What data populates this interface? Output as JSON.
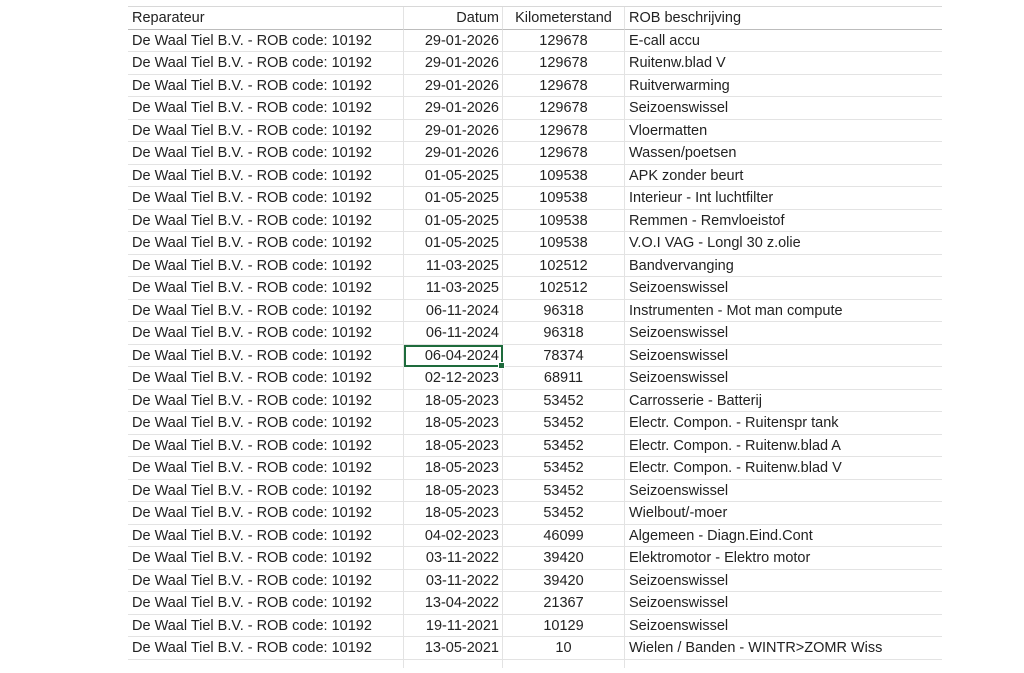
{
  "sheet": {
    "headers": {
      "reparateur": "Reparateur",
      "datum": "Datum",
      "kilometerstand": "Kilometerstand",
      "rob": "ROB beschrijving"
    },
    "selected_row_index": 14,
    "selection_color": "#1e6b3c",
    "rows": [
      {
        "reparateur": "De Waal Tiel B.V. - ROB code: 10192",
        "datum": "29-01-2026",
        "km": "129678",
        "rob": "E-call accu"
      },
      {
        "reparateur": "De Waal Tiel B.V. - ROB code: 10192",
        "datum": "29-01-2026",
        "km": "129678",
        "rob": "Ruitenw.blad V"
      },
      {
        "reparateur": "De Waal Tiel B.V. - ROB code: 10192",
        "datum": "29-01-2026",
        "km": "129678",
        "rob": "Ruitverwarming"
      },
      {
        "reparateur": "De Waal Tiel B.V. - ROB code: 10192",
        "datum": "29-01-2026",
        "km": "129678",
        "rob": "Seizoenswissel"
      },
      {
        "reparateur": "De Waal Tiel B.V. - ROB code: 10192",
        "datum": "29-01-2026",
        "km": "129678",
        "rob": "Vloermatten"
      },
      {
        "reparateur": "De Waal Tiel B.V. - ROB code: 10192",
        "datum": "29-01-2026",
        "km": "129678",
        "rob": "Wassen/poetsen"
      },
      {
        "reparateur": "De Waal Tiel B.V. - ROB code: 10192",
        "datum": "01-05-2025",
        "km": "109538",
        "rob": "APK zonder beurt"
      },
      {
        "reparateur": "De Waal Tiel B.V. - ROB code: 10192",
        "datum": "01-05-2025",
        "km": "109538",
        "rob": "Interieur - Int luchtfilter"
      },
      {
        "reparateur": "De Waal Tiel B.V. - ROB code: 10192",
        "datum": "01-05-2025",
        "km": "109538",
        "rob": "Remmen - Remvloeistof"
      },
      {
        "reparateur": "De Waal Tiel B.V. - ROB code: 10192",
        "datum": "01-05-2025",
        "km": "109538",
        "rob": "V.O.I VAG - Longl 30 z.olie"
      },
      {
        "reparateur": "De Waal Tiel B.V. - ROB code: 10192",
        "datum": "11-03-2025",
        "km": "102512",
        "rob": "Bandvervanging"
      },
      {
        "reparateur": "De Waal Tiel B.V. - ROB code: 10192",
        "datum": "11-03-2025",
        "km": "102512",
        "rob": "Seizoenswissel"
      },
      {
        "reparateur": "De Waal Tiel B.V. - ROB code: 10192",
        "datum": "06-11-2024",
        "km": "96318",
        "rob": "Instrumenten - Mot man compute"
      },
      {
        "reparateur": "De Waal Tiel B.V. - ROB code: 10192",
        "datum": "06-11-2024",
        "km": "96318",
        "rob": "Seizoenswissel"
      },
      {
        "reparateur": "De Waal Tiel B.V. - ROB code: 10192",
        "datum": "06-04-2024",
        "km": "78374",
        "rob": "Seizoenswissel"
      },
      {
        "reparateur": "De Waal Tiel B.V. - ROB code: 10192",
        "datum": "02-12-2023",
        "km": "68911",
        "rob": "Seizoenswissel"
      },
      {
        "reparateur": "De Waal Tiel B.V. - ROB code: 10192",
        "datum": "18-05-2023",
        "km": "53452",
        "rob": "Carrosserie - Batterij"
      },
      {
        "reparateur": "De Waal Tiel B.V. - ROB code: 10192",
        "datum": "18-05-2023",
        "km": "53452",
        "rob": "Electr. Compon. - Ruitenspr tank"
      },
      {
        "reparateur": "De Waal Tiel B.V. - ROB code: 10192",
        "datum": "18-05-2023",
        "km": "53452",
        "rob": "Electr. Compon. - Ruitenw.blad A"
      },
      {
        "reparateur": "De Waal Tiel B.V. - ROB code: 10192",
        "datum": "18-05-2023",
        "km": "53452",
        "rob": "Electr. Compon. - Ruitenw.blad V"
      },
      {
        "reparateur": "De Waal Tiel B.V. - ROB code: 10192",
        "datum": "18-05-2023",
        "km": "53452",
        "rob": "Seizoenswissel"
      },
      {
        "reparateur": "De Waal Tiel B.V. - ROB code: 10192",
        "datum": "18-05-2023",
        "km": "53452",
        "rob": "Wielbout/-moer"
      },
      {
        "reparateur": "De Waal Tiel B.V. - ROB code: 10192",
        "datum": "04-02-2023",
        "km": "46099",
        "rob": "Algemeen - Diagn.Eind.Cont"
      },
      {
        "reparateur": "De Waal Tiel B.V. - ROB code: 10192",
        "datum": "03-11-2022",
        "km": "39420",
        "rob": "Elektromotor - Elektro motor"
      },
      {
        "reparateur": "De Waal Tiel B.V. - ROB code: 10192",
        "datum": "03-11-2022",
        "km": "39420",
        "rob": "Seizoenswissel"
      },
      {
        "reparateur": "De Waal Tiel B.V. - ROB code: 10192",
        "datum": "13-04-2022",
        "km": "21367",
        "rob": "Seizoenswissel"
      },
      {
        "reparateur": "De Waal Tiel B.V. - ROB code: 10192",
        "datum": "19-11-2021",
        "km": "10129",
        "rob": "Seizoenswissel"
      },
      {
        "reparateur": "De Waal Tiel B.V. - ROB code: 10192",
        "datum": "13-05-2021",
        "km": "10",
        "rob": "Wielen / Banden - WINTR>ZOMR Wiss"
      }
    ]
  }
}
